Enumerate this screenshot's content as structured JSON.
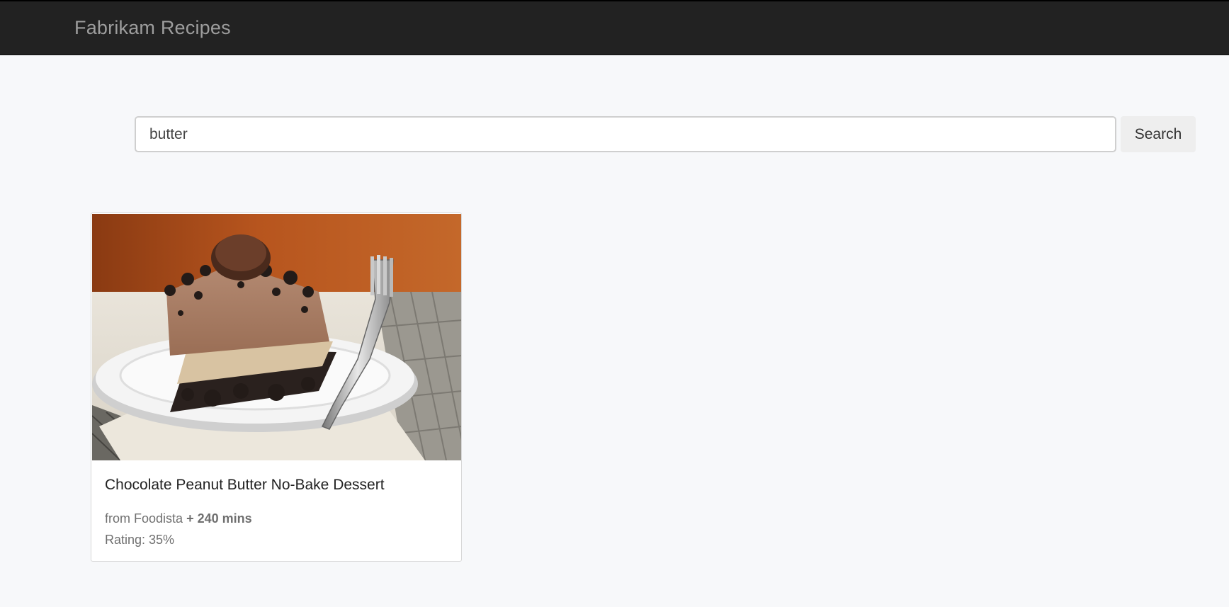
{
  "navbar": {
    "brand": "Fabrikam Recipes",
    "background": "#222222",
    "brand_color": "#9d9d9d"
  },
  "search": {
    "value": "butter",
    "button_label": "Search"
  },
  "results": [
    {
      "title": "Chocolate Peanut Butter No-Bake Dessert",
      "source_prefix": "from Foodista",
      "duration": "+ 240 mins",
      "rating": "Rating: 35%",
      "image_description": "dessert-photo"
    }
  ]
}
